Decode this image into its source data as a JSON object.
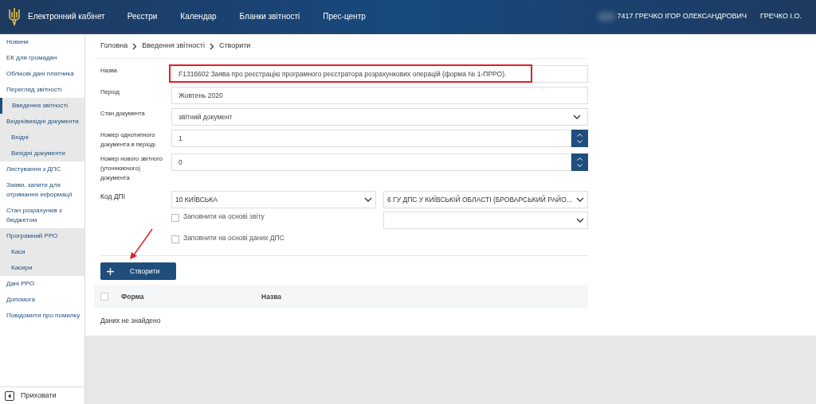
{
  "header": {
    "logo_title": "Електронний кабінет",
    "nav": [
      "Реєстри",
      "Календар",
      "Бланки звітності",
      "Прес-центр"
    ],
    "user_code": "7417 ГРЕЧКО ІГОР ОЛЕКСАНДРОВИЧ",
    "user_short": "ГРЕЧКО І.О."
  },
  "sidebar": {
    "items": [
      {
        "label": "Новини",
        "selected": false
      },
      {
        "label": "ЕК для громадян",
        "selected": false
      },
      {
        "label": "Облікові дані платника",
        "selected": false
      },
      {
        "label": "Перегляд звітності",
        "selected": false
      },
      {
        "label": "Введення звітності",
        "selected": true
      },
      {
        "label": "Вхідні/вихідні документи",
        "selected": false,
        "expanded": true,
        "children": [
          {
            "label": "Вхідні",
            "selected": false
          },
          {
            "label": "Вихідні документи",
            "selected": false
          }
        ]
      },
      {
        "label": "Листування з ДПС",
        "selected": false
      },
      {
        "label": "Заяви, запити для отримання інформації",
        "selected": false
      },
      {
        "label": "Стан розрахунків з бюджетом",
        "selected": false
      },
      {
        "label": "Програмний РРО",
        "selected": false,
        "expanded": true,
        "children": [
          {
            "label": "Каси",
            "selected": false
          },
          {
            "label": "Касири",
            "selected": false
          }
        ]
      },
      {
        "label": "Дані РРО",
        "selected": false
      },
      {
        "label": "Допомога",
        "selected": false
      },
      {
        "label": "Повідомити про помилку",
        "selected": false
      }
    ],
    "hide_button": "Приховати"
  },
  "breadcrumb": [
    "Головна",
    "Введення звітності",
    "Створити"
  ],
  "form": {
    "fields": [
      {
        "kind": "text",
        "label": "Назва",
        "value": "F1316602 Заява про реєстрацію програмного реєстратора розрахункових операцій (форма № 1-ПРРО).",
        "highlighted": true
      },
      {
        "kind": "text",
        "label": "Період",
        "value": "Жовтень 2020",
        "highlighted": false
      },
      {
        "kind": "select",
        "label": "Стан документа",
        "value": "звітний документ",
        "highlighted": false
      },
      {
        "kind": "number",
        "label": "Номер однотипного документа в періоді",
        "value": "1",
        "highlighted": false
      },
      {
        "kind": "number",
        "label": "Номер нового звітного (уточнюючого) документа",
        "value": "0",
        "highlighted": false
      }
    ],
    "dpi": {
      "label": "Код ДПІ",
      "region": "10 КИЇВСЬКА",
      "office": "6 ГУ ДПС У КИЇВСЬКІЙ ОБЛАСТІ (БРОВАРСЬКИЙ РАЙО...",
      "checkboxes": [
        {
          "label": "Заповнити на основі звіту",
          "checked": false
        },
        {
          "label": "Заповнити на основі даних ДПС",
          "checked": false
        }
      ]
    }
  },
  "create_button": "Створити",
  "table": {
    "select_all_checked": false,
    "columns": [
      "Форма",
      "Назва"
    ],
    "empty_text": "Даних не знайдено"
  }
}
